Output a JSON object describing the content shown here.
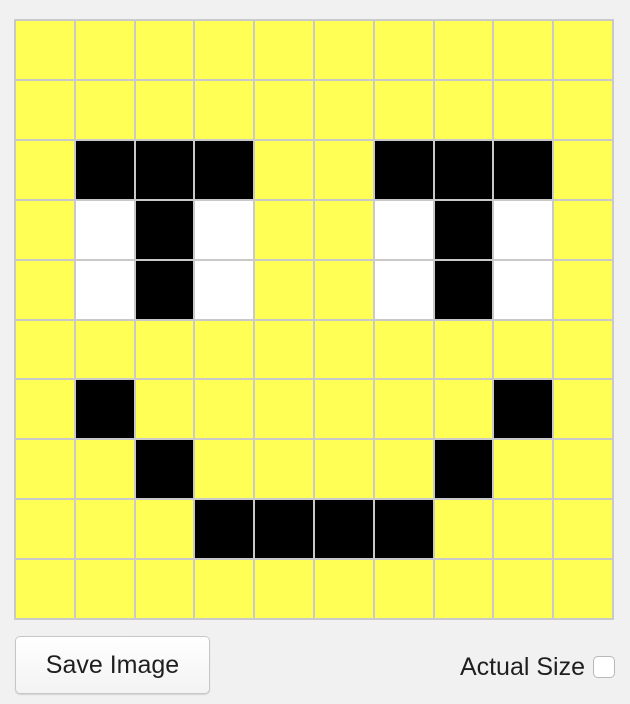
{
  "pixel_editor": {
    "palette": {
      "Y": "#ffff55",
      "K": "#000000",
      "W": "#ffffff"
    },
    "grid": [
      [
        "Y",
        "Y",
        "Y",
        "Y",
        "Y",
        "Y",
        "Y",
        "Y",
        "Y",
        "Y"
      ],
      [
        "Y",
        "Y",
        "Y",
        "Y",
        "Y",
        "Y",
        "Y",
        "Y",
        "Y",
        "Y"
      ],
      [
        "Y",
        "K",
        "K",
        "K",
        "Y",
        "Y",
        "K",
        "K",
        "K",
        "Y"
      ],
      [
        "Y",
        "W",
        "K",
        "W",
        "Y",
        "Y",
        "W",
        "K",
        "W",
        "Y"
      ],
      [
        "Y",
        "W",
        "K",
        "W",
        "Y",
        "Y",
        "W",
        "K",
        "W",
        "Y"
      ],
      [
        "Y",
        "Y",
        "Y",
        "Y",
        "Y",
        "Y",
        "Y",
        "Y",
        "Y",
        "Y"
      ],
      [
        "Y",
        "K",
        "Y",
        "Y",
        "Y",
        "Y",
        "Y",
        "Y",
        "K",
        "Y"
      ],
      [
        "Y",
        "Y",
        "K",
        "Y",
        "Y",
        "Y",
        "Y",
        "K",
        "Y",
        "Y"
      ],
      [
        "Y",
        "Y",
        "Y",
        "K",
        "K",
        "K",
        "K",
        "Y",
        "Y",
        "Y"
      ],
      [
        "Y",
        "Y",
        "Y",
        "Y",
        "Y",
        "Y",
        "Y",
        "Y",
        "Y",
        "Y"
      ]
    ]
  },
  "controls": {
    "save_label": "Save Image",
    "actual_size_label": "Actual Size",
    "actual_size_checked": false
  }
}
